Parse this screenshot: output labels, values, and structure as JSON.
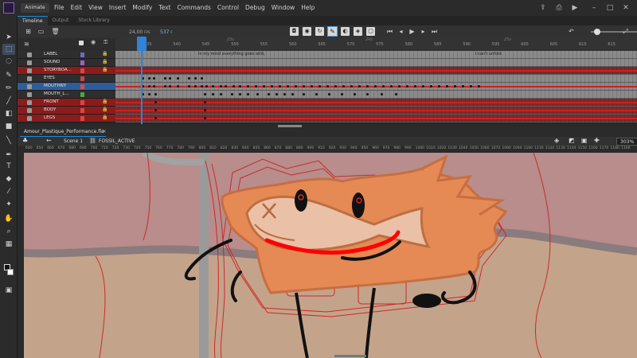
{
  "app": {
    "badge": "Animate",
    "menus": [
      "File",
      "Edit",
      "View",
      "Insert",
      "Modify",
      "Text",
      "Commands",
      "Control",
      "Debug",
      "Window",
      "Help"
    ]
  },
  "panel_tabs": [
    "Timeline",
    "Output",
    "Stock Library"
  ],
  "timeline": {
    "fps": "24,00",
    "fps_unit": "FPS",
    "current_frame": "537",
    "frame_unit": "F",
    "ruler_numbers": [
      "535",
      "540",
      "545",
      "550",
      "555",
      "560",
      "565",
      "570",
      "575",
      "580",
      "585",
      "590",
      "595",
      "600",
      "605",
      "610",
      "615",
      "620"
    ],
    "ruler_seconds": [
      "23s",
      "24s",
      "25s"
    ],
    "label_texts": [
      "In my mind everything goes wild,",
      "I can't unfold"
    ],
    "layers": [
      {
        "name": "LABEL",
        "style": "normal",
        "color": "#6a6acc"
      },
      {
        "name": "SOUND",
        "style": "normal",
        "color": "#9a62d0"
      },
      {
        "name": "STORYBOA...",
        "style": "red",
        "color": "#e04444"
      },
      {
        "name": "EYES",
        "style": "normal",
        "color": "#cc4444"
      },
      {
        "name": "MOUTHNY",
        "style": "blue",
        "color": "#d04f4f"
      },
      {
        "name": "MOUTH_L...",
        "style": "normal",
        "color": "#44aa44"
      },
      {
        "name": "FRONT",
        "style": "red",
        "color": "#e04444"
      },
      {
        "name": "BODY",
        "style": "red",
        "color": "#e04444"
      },
      {
        "name": "LEGS",
        "style": "red",
        "color": "#e04444"
      }
    ]
  },
  "document": {
    "tab_label": "Amour_Plastique_Performance.fla",
    "breadcrumb": [
      "Scene 1",
      "FOSSIL_ACTIVE"
    ],
    "zoom": "303%",
    "h_ruler": [
      "640",
      "650",
      "660",
      "670",
      "680",
      "690",
      "700",
      "710",
      "720",
      "730",
      "740",
      "750",
      "760",
      "770",
      "780",
      "790",
      "800",
      "810",
      "820",
      "830",
      "840",
      "850",
      "860",
      "870",
      "880",
      "890",
      "900",
      "910",
      "920",
      "930",
      "940",
      "950",
      "960",
      "970",
      "980",
      "990",
      "1000",
      "1010",
      "1020",
      "1030",
      "1040",
      "1050",
      "1060",
      "1070",
      "1080",
      "1090",
      "1100",
      "1110",
      "1120",
      "1130",
      "1140",
      "1150",
      "1160",
      "1170",
      "1180",
      "1190",
      "1200"
    ]
  },
  "colors": {
    "accent": "#2f83d8",
    "character_fill": "#e58a55",
    "character_stroke": "#b86a3e",
    "mouth": "#ff0000",
    "sky": "#b98b8b",
    "ground": "#c7a488",
    "onion_skin": "#cc2a2a"
  }
}
